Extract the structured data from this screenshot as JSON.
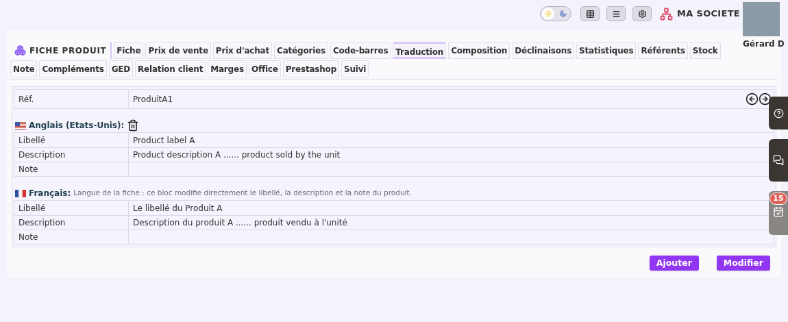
{
  "top_bar": {
    "theme_toggle": {
      "dark": false
    },
    "company": "MA SOCIETE",
    "user": {
      "name": "Gérard D"
    }
  },
  "page": {
    "title": "FICHE PRODUIT",
    "tabs": [
      {
        "label": "Fiche",
        "selected": false
      },
      {
        "label": "Prix de vente",
        "selected": false
      },
      {
        "label": "Prix d'achat",
        "selected": false
      },
      {
        "label": "Catégories",
        "selected": false
      },
      {
        "label": "Code-barres",
        "selected": false
      },
      {
        "label": "Traduction",
        "selected": true
      },
      {
        "label": "Composition",
        "selected": false
      },
      {
        "label": "Déclinaisons",
        "selected": false
      },
      {
        "label": "Statistiques",
        "selected": false
      },
      {
        "label": "Référents",
        "selected": false
      },
      {
        "label": "Stock",
        "selected": false
      },
      {
        "label": "Note",
        "selected": false
      },
      {
        "label": "Compléments",
        "selected": false
      },
      {
        "label": "GED",
        "selected": false
      },
      {
        "label": "Relation client",
        "selected": false
      },
      {
        "label": "Marges",
        "selected": false
      },
      {
        "label": "Office",
        "selected": false
      },
      {
        "label": "Prestashop",
        "selected": false
      },
      {
        "label": "Suivi",
        "selected": false
      }
    ]
  },
  "ref": {
    "label": "Réf.",
    "value": "ProduitA1"
  },
  "translations": [
    {
      "language": "Anglais (Etats-Unis):",
      "kind": "us",
      "deletable": true,
      "rows": [
        {
          "label": "Libellé",
          "value": "Product label A"
        },
        {
          "label": "Description",
          "value": "Product description A ...... product sold by the unit"
        },
        {
          "label": "Note"
        }
      ]
    },
    {
      "language": "Français:",
      "kind": "fr",
      "deletable": false,
      "hint": "Langue de la fiche : ce bloc modifie directement le libellé, la description et la note du produit.",
      "rows": [
        {
          "label": "Libellé",
          "value": "Le libellé du Produit A"
        },
        {
          "label": "Description",
          "value": "Description du produit A ...... produit vendu à l'unité"
        },
        {
          "label": "Note"
        }
      ]
    }
  ],
  "side_tabs": [
    {
      "kind": "help"
    },
    {
      "kind": "chat"
    },
    {
      "kind": "agenda",
      "badge": "15"
    }
  ],
  "buttons": [
    "Ajouter",
    "Modifier"
  ]
}
